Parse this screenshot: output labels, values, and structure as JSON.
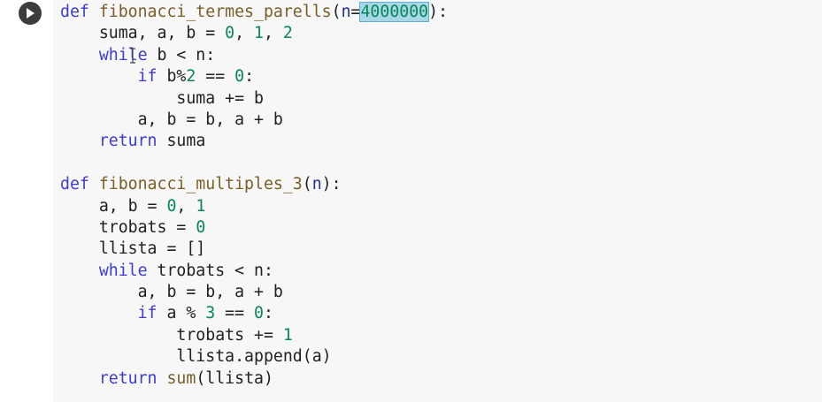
{
  "cell": {
    "run_icon": "play-icon",
    "colors": {
      "editor_bg": "#f7f7f7",
      "keyword": "#3b3bd6",
      "function": "#795e26",
      "number": "#098658",
      "selection": "#a8d8e8"
    },
    "code": {
      "l0": {
        "kw": "def",
        "sp1": " ",
        "fn": "fibonacci_termes_parells",
        "p1": "(",
        "param": "n",
        "eq": "=",
        "num": "4000000",
        "p2": "):"
      },
      "l1": {
        "indent": "    ",
        "t1": "suma, a, b = ",
        "n1": "0",
        "c1": ", ",
        "n2": "1",
        "c2": ", ",
        "n3": "2"
      },
      "l2": {
        "indent": "    ",
        "kw": "while",
        "rest": " b < n:"
      },
      "l3": {
        "indent": "        ",
        "kw": "if",
        "t1": " b%",
        "n1": "2",
        "t2": " == ",
        "n2": "0",
        "t3": ":"
      },
      "l4": {
        "indent": "            ",
        "text": "suma += b"
      },
      "l5": {
        "indent": "        ",
        "text": "a, b = b, a + b"
      },
      "l6": {
        "indent": "    ",
        "kw": "return",
        "rest": " suma"
      },
      "l7": {
        "text": ""
      },
      "l8": {
        "kw": "def",
        "sp1": " ",
        "fn": "fibonacci_multiples_3",
        "p1": "(",
        "param": "n",
        "p2": "):"
      },
      "l9": {
        "indent": "    ",
        "t1": "a, b = ",
        "n1": "0",
        "c1": ", ",
        "n2": "1"
      },
      "l10": {
        "indent": "    ",
        "t1": "trobats = ",
        "n1": "0"
      },
      "l11": {
        "indent": "    ",
        "text": "llista = []"
      },
      "l12": {
        "indent": "    ",
        "kw": "while",
        "rest": " trobats < n:"
      },
      "l13": {
        "indent": "        ",
        "text": "a, b = b, a + b"
      },
      "l14": {
        "indent": "        ",
        "kw": "if",
        "t1": " a % ",
        "n1": "3",
        "t2": " == ",
        "n2": "0",
        "t3": ":"
      },
      "l15": {
        "indent": "            ",
        "t1": "trobats += ",
        "n1": "1"
      },
      "l16": {
        "indent": "            ",
        "text": "llista.append(a)"
      },
      "l17": {
        "indent": "    ",
        "kw": "return",
        "sp1": " ",
        "fn": "sum",
        "rest": "(llista)"
      }
    }
  }
}
